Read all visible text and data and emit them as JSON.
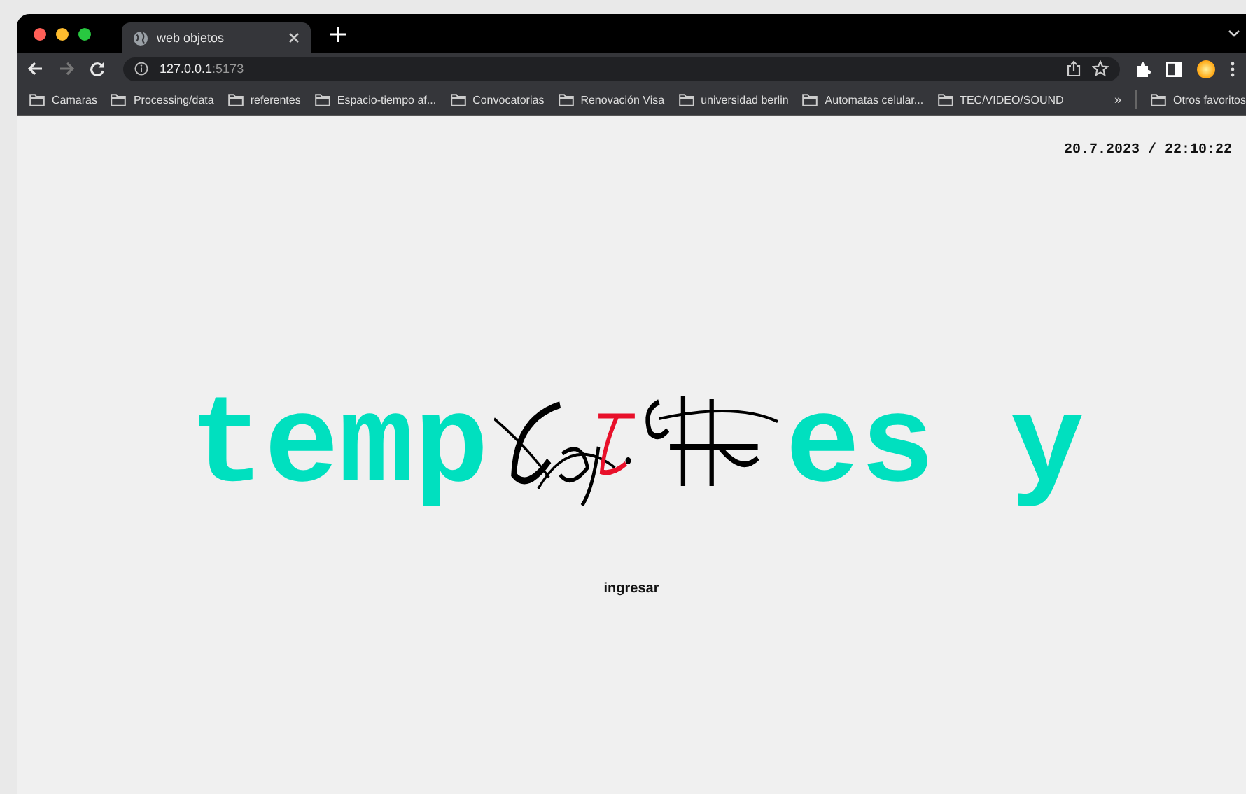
{
  "tab": {
    "title": "web objetos",
    "selected": true
  },
  "toolbar": {
    "nav": [
      {
        "kind": "back",
        "disabled": false
      },
      {
        "kind": "forward",
        "disabled": true
      },
      {
        "kind": "reload",
        "disabled": false
      }
    ],
    "url_host": "127.0.0.1",
    "url_port": ":5173"
  },
  "bookmarks": [
    "Camaras",
    "Processing/data",
    "referentes",
    "Espacio-tiempo af...",
    "Convocatorias",
    "Renovación Visa",
    "universidad berlin",
    "Automatas celular...",
    "TEC/VIDEO/SOUND"
  ],
  "bookmarks_more": "»",
  "other_bookmarks": "Otros favoritos",
  "page": {
    "timestamp": "20.7.2023 / 22:10:22",
    "heading_start": "temp",
    "heading_end": "es y",
    "button": "ingresar"
  }
}
